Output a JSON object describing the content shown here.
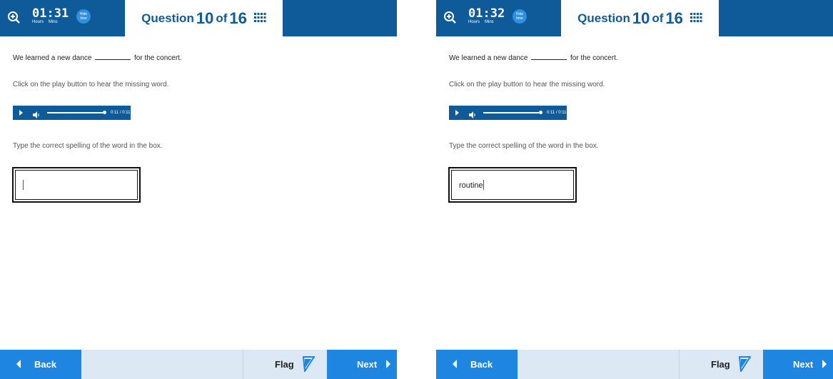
{
  "panels": [
    {
      "header": {
        "time": "01:31",
        "hours_label": "Hours",
        "mins_label": "Mins",
        "hide_time_label": "Hide time",
        "question_prefix": "Question",
        "question_number": "10",
        "question_of": "of",
        "question_total": "16"
      },
      "content": {
        "sentence_start": "We learned a new dance",
        "sentence_end": "for the concert.",
        "instruction_play": "Click on the play button to hear the missing word.",
        "player_time": "0:11 / 0:11",
        "instruction_type": "Type the correct spelling of the word in the box.",
        "answer_value": ""
      },
      "footer": {
        "back_label": "Back",
        "flag_label": "Flag",
        "next_label": "Next"
      }
    },
    {
      "header": {
        "time": "01:32",
        "hours_label": "Hours",
        "mins_label": "Mins",
        "hide_time_label": "Hide time",
        "question_prefix": "Question",
        "question_number": "10",
        "question_of": "of",
        "question_total": "16"
      },
      "content": {
        "sentence_start": "We learned a new dance",
        "sentence_end": "for the concert.",
        "instruction_play": "Click on the play button to hear the missing word.",
        "player_time": "0:11 / 0:11",
        "instruction_type": "Type the correct spelling of the word in the box.",
        "answer_value": "routine"
      },
      "footer": {
        "back_label": "Back",
        "flag_label": "Flag",
        "next_label": "Next"
      }
    }
  ],
  "colors": {
    "header_blue": "#0f5b9a",
    "button_blue": "#1e86e0",
    "footer_bg": "#dce8f4"
  }
}
